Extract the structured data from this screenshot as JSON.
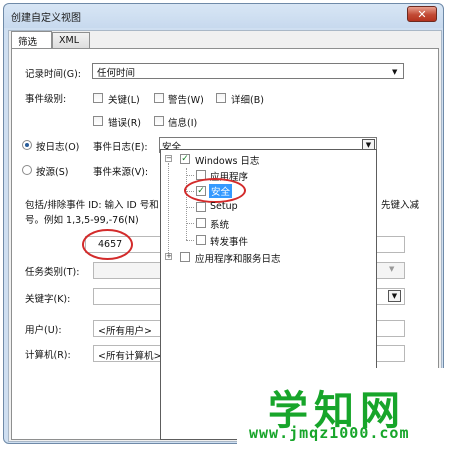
{
  "window": {
    "title": "创建自定义视图",
    "close_glyph": "✕"
  },
  "tabs": [
    {
      "label": "筛选器"
    },
    {
      "label": "XML"
    }
  ],
  "filter": {
    "logged_label": "记录时间(G):",
    "logged_value": "任何时间",
    "level_label": "事件级别:",
    "levels": [
      {
        "label": "关键(L)"
      },
      {
        "label": "警告(W)"
      },
      {
        "label": "详细(B)"
      },
      {
        "label": "错误(R)"
      },
      {
        "label": "信息(I)"
      }
    ],
    "by_log_label": "按日志(O)",
    "by_source_label": "按源(S)",
    "event_log_label": "事件日志(E):",
    "event_log_value": "安全",
    "event_source_label": "事件来源(V):",
    "desc_line1": "包括/排除事件 ID: 输入 ID 号和",
    "desc_line1_right": "先键入减",
    "desc_line2": "号。例如 1,3,5-99,-76(N)",
    "event_id_value": "4657",
    "task_category_label": "任务类别(T):",
    "keywords_label": "关键字(K):",
    "user_label": "用户(U):",
    "user_value": "<所有用户>",
    "computer_label": "计算机(R):",
    "computer_value": "<所有计算机>"
  },
  "dropdown": {
    "root": "Windows 日志",
    "items": [
      {
        "label": "应用程序",
        "checked": false
      },
      {
        "label": "安全",
        "checked": true
      },
      {
        "label": "Setup",
        "checked": false
      },
      {
        "label": "系统",
        "checked": false
      },
      {
        "label": "转发事件",
        "checked": false
      }
    ],
    "root2": "应用程序和服务日志"
  },
  "watermark": {
    "title": "学知网",
    "url": "www.jmqz1000.com"
  },
  "colors": {
    "highlight_red": "#d32b2b",
    "watermark_green": "#17a52a",
    "selection_blue": "#3399ff"
  }
}
